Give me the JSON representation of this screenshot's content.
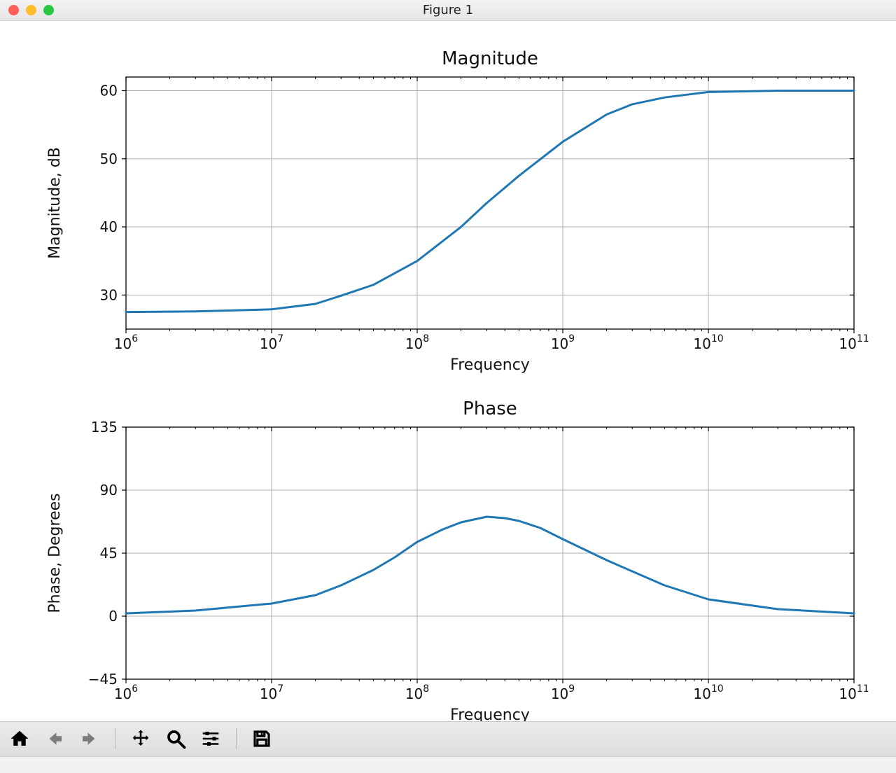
{
  "window": {
    "title": "Figure 1"
  },
  "colors": {
    "line": "#1f77b4",
    "grid": "#b0b0b0",
    "frame": "#000000"
  },
  "toolbar": {
    "items": [
      {
        "name": "home",
        "enabled": true
      },
      {
        "name": "back",
        "enabled": false
      },
      {
        "name": "forward",
        "enabled": false
      },
      {
        "name": "pan",
        "enabled": true
      },
      {
        "name": "zoom",
        "enabled": true
      },
      {
        "name": "configure",
        "enabled": true
      },
      {
        "name": "save",
        "enabled": true
      }
    ]
  },
  "chart_data": [
    {
      "type": "line",
      "title": "Magnitude",
      "xlabel": "Frequency",
      "ylabel": "Magnitude, dB",
      "xscale": "log",
      "xlim": [
        1000000.0,
        100000000000.0
      ],
      "ylim": [
        25,
        62
      ],
      "xticks_exp": [
        6,
        7,
        8,
        9,
        10,
        11
      ],
      "yticks": [
        30,
        40,
        50,
        60
      ],
      "series": [
        {
          "name": "magnitude",
          "points": [
            [
              1000000.0,
              27.5
            ],
            [
              3000000.0,
              27.6
            ],
            [
              10000000.0,
              27.9
            ],
            [
              20000000.0,
              28.7
            ],
            [
              30000000.0,
              29.9
            ],
            [
              50000000.0,
              31.5
            ],
            [
              100000000.0,
              35.0
            ],
            [
              200000000.0,
              40.0
            ],
            [
              300000000.0,
              43.5
            ],
            [
              500000000.0,
              47.5
            ],
            [
              1000000000.0,
              52.5
            ],
            [
              2000000000.0,
              56.5
            ],
            [
              3000000000.0,
              58.0
            ],
            [
              5000000000.0,
              59.0
            ],
            [
              10000000000.0,
              59.8
            ],
            [
              30000000000.0,
              60.0
            ],
            [
              100000000000.0,
              60.0
            ]
          ]
        }
      ]
    },
    {
      "type": "line",
      "title": "Phase",
      "xlabel": "Frequency",
      "ylabel": "Phase, Degrees",
      "xscale": "log",
      "xlim": [
        1000000.0,
        100000000000.0
      ],
      "ylim": [
        -45,
        135
      ],
      "xticks_exp": [
        6,
        7,
        8,
        9,
        10,
        11
      ],
      "yticks": [
        -45,
        0,
        45,
        90,
        135
      ],
      "series": [
        {
          "name": "phase",
          "points": [
            [
              1000000.0,
              2.0
            ],
            [
              3000000.0,
              4.0
            ],
            [
              10000000.0,
              9.0
            ],
            [
              20000000.0,
              15.0
            ],
            [
              30000000.0,
              22.0
            ],
            [
              50000000.0,
              33.0
            ],
            [
              70000000.0,
              42.0
            ],
            [
              100000000.0,
              53.0
            ],
            [
              150000000.0,
              62.0
            ],
            [
              200000000.0,
              67.0
            ],
            [
              300000000.0,
              71.0
            ],
            [
              400000000.0,
              70.0
            ],
            [
              500000000.0,
              68.0
            ],
            [
              700000000.0,
              63.0
            ],
            [
              1000000000.0,
              55.0
            ],
            [
              2000000000.0,
              40.0
            ],
            [
              3000000000.0,
              32.0
            ],
            [
              5000000000.0,
              22.0
            ],
            [
              10000000000.0,
              12.0
            ],
            [
              30000000000.0,
              5.0
            ],
            [
              100000000000.0,
              2.0
            ]
          ]
        }
      ]
    }
  ]
}
